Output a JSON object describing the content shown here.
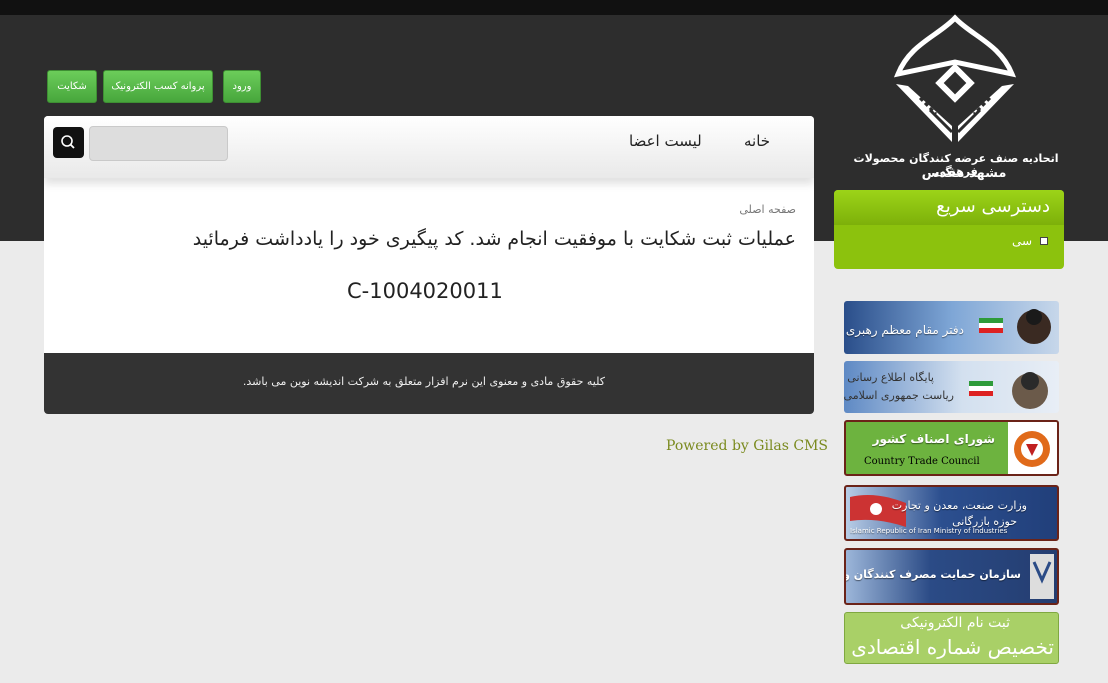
{
  "header": {
    "org_line1": "اتحادیه صنف عرضه کنندگان محصولات فرهنگی",
    "org_line2": "مشهد مقدس",
    "buttons": {
      "complaint": "شکایت",
      "license": "پروانه کسب الکترونیک",
      "login": "ورود"
    }
  },
  "nav": {
    "home": "خانه",
    "members": "لیست اعضا",
    "search_placeholder": ""
  },
  "content": {
    "breadcrumb": "صفحه اصلی",
    "message": "عملیات ثبت شکایت با موفقیت انجام شد. کد پیگیری خود را یادداشت فرمائید",
    "tracking_code": "C-1004020011"
  },
  "footer": {
    "copyright": "کلیه حقوق مادی و معنوی این نرم افزار متعلق به شرکت اندیشه نوین می باشد.",
    "powered": "Powered by Gilas CMS"
  },
  "sidebar": {
    "quick_title": "دسترسی سریع",
    "quick_items": [
      {
        "label": "سی"
      }
    ],
    "banners": {
      "b1": "دفتر مقام معظم رهبری",
      "b2_line1": "پایگاه اطلاع رسانی",
      "b2_line2": "ریاست جمهوری اسلامی ایران",
      "b3_fa": "شورای اصناف کشور",
      "b3_en": "Country Trade Council",
      "b4_line1": "وزارت صنعت، معدن و تجارت",
      "b4_line2": "حوزه بازرگانی",
      "b4_en": "Islamic Republic of Iran Ministry of Industries",
      "b5": "سازمان حمایت مصرف کنندگان و تولیدکنندگان",
      "b6_line1": "ثبت نام الکترونیکی",
      "b6_line2": "تخصیص شماره اقتصادی"
    }
  },
  "colors": {
    "accent_green": "#8cc20d",
    "button_green": "#5cb84b",
    "dark_header": "#2d2d2d"
  }
}
